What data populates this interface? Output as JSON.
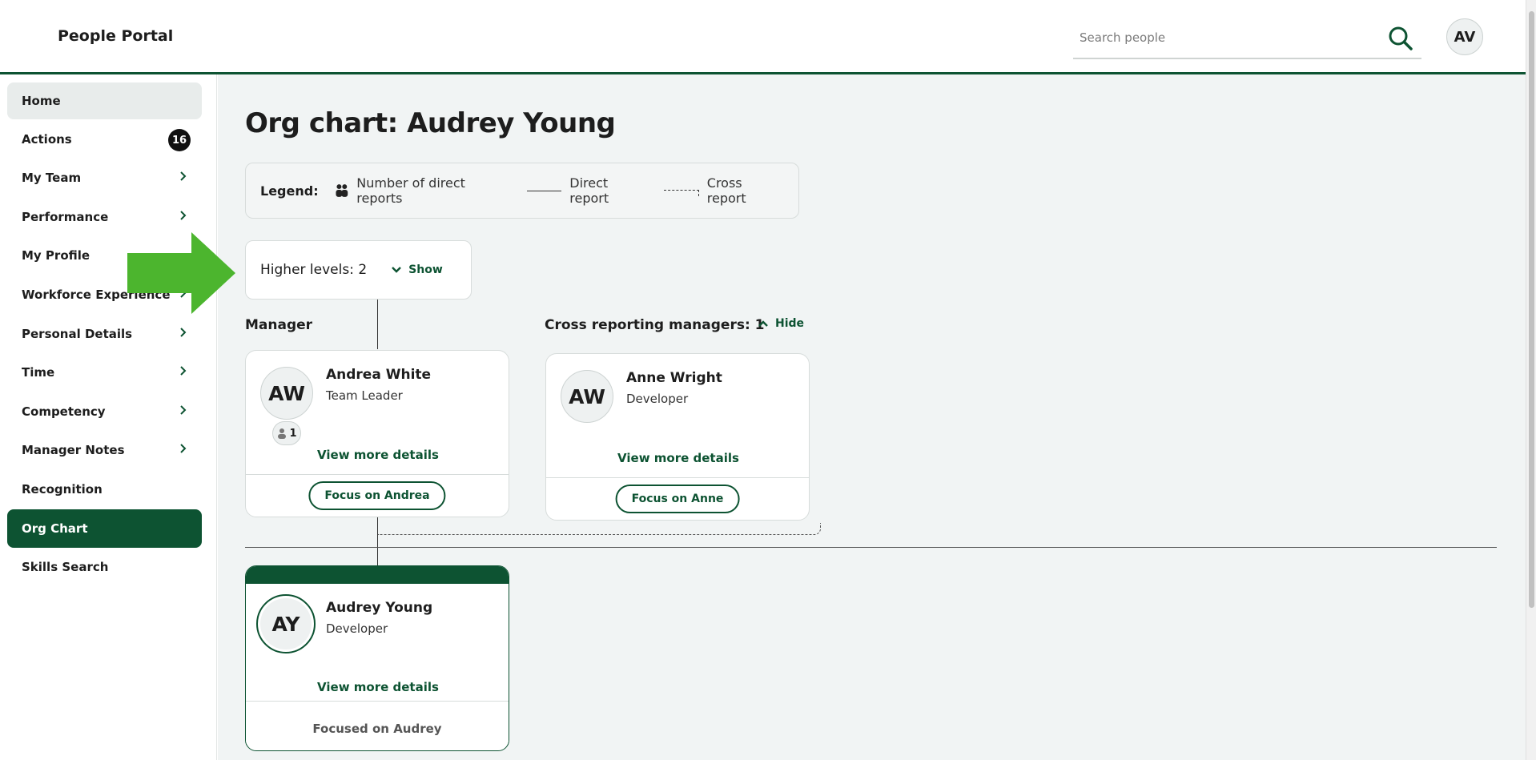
{
  "header": {
    "brand": "People Portal",
    "search_placeholder": "Search people",
    "user_initials": "AV"
  },
  "sidebar": {
    "items": [
      {
        "label": "Home"
      },
      {
        "label": "Actions",
        "badge": "16"
      },
      {
        "label": "My Team"
      },
      {
        "label": "Performance"
      },
      {
        "label": "My Profile"
      },
      {
        "label": "Workforce Experience"
      },
      {
        "label": "Personal Details"
      },
      {
        "label": "Time"
      },
      {
        "label": "Competency"
      },
      {
        "label": "Manager Notes"
      },
      {
        "label": "Recognition"
      },
      {
        "label": "Org Chart"
      },
      {
        "label": "Skills Search"
      }
    ]
  },
  "main": {
    "title": "Org chart: Audrey Young",
    "legend": {
      "label": "Legend:",
      "direct_reports_count": "Number of direct reports",
      "direct_report": "Direct report",
      "cross_report": "Cross report"
    },
    "higher_levels": {
      "text": "Higher levels: 2",
      "toggle_label": "Show"
    },
    "manager_label": "Manager",
    "cross_managers": {
      "label": "Cross reporting managers: 1",
      "toggle_label": "Hide"
    },
    "manager_card": {
      "initials": "AW",
      "name": "Andrea White",
      "role": "Team Leader",
      "reports": "1",
      "view_more": "View more details",
      "focus_label": "Focus on Andrea"
    },
    "cross_card": {
      "initials": "AW",
      "name": "Anne Wright",
      "role": "Developer",
      "view_more": "View more details",
      "focus_label": "Focus on Anne"
    },
    "focused_card": {
      "initials": "AY",
      "name": "Audrey Young",
      "role": "Developer",
      "view_more": "View more details",
      "focused_text": "Focused on Audrey"
    }
  },
  "colors": {
    "brand_green": "#0d5332",
    "annotation_arrow": "#4cb52e",
    "main_bg": "#f1f4f4"
  }
}
